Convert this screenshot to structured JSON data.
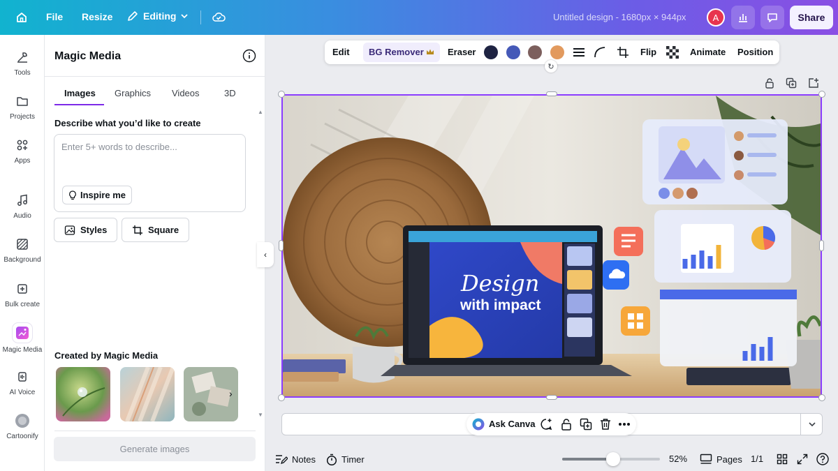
{
  "colors": {
    "accent": "#8b3dff",
    "topbar_start": "#11b3cf",
    "topbar_end": "#8a4fe4"
  },
  "topbar": {
    "file_label": "File",
    "resize_label": "Resize",
    "editing_label": "Editing",
    "design_title": "Untitled design - 1680px × 944px",
    "avatar_initial": "A",
    "share_label": "Share"
  },
  "rail": {
    "items": [
      {
        "label": "Tools",
        "icon": "tools-icon"
      },
      {
        "label": "Projects",
        "icon": "folder-icon"
      },
      {
        "label": "Apps",
        "icon": "apps-icon"
      },
      {
        "label": "Audio",
        "icon": "music-note-icon"
      },
      {
        "label": "Background",
        "icon": "background-icon"
      },
      {
        "label": "Bulk create",
        "icon": "bulk-create-icon"
      },
      {
        "label": "Magic Media",
        "icon": "magic-media-icon"
      },
      {
        "label": "AI Voice",
        "icon": "ai-voice-icon"
      },
      {
        "label": "Cartoonify",
        "icon": "cartoonify-icon"
      }
    ]
  },
  "panel": {
    "title": "Magic Media",
    "tabs": [
      "Images",
      "Graphics",
      "Videos",
      "3D"
    ],
    "active_tab": "Images",
    "prompt_label": "Describe what you’d like to create",
    "prompt_placeholder": "Enter 5+ words to describe...",
    "prompt_value": "",
    "inspire_label": "Inspire me",
    "styles_label": "Styles",
    "aspect_label": "Square",
    "created_label": "Created by Magic Media",
    "generate_label": "Generate images"
  },
  "context_toolbar": {
    "edit_label": "Edit",
    "bg_remover_label": "BG Remover",
    "eraser_label": "Eraser",
    "swatches": [
      "#1e2342",
      "#4559b8",
      "#7c5f5d",
      "#e29a5e"
    ],
    "flip_label": "Flip",
    "animate_label": "Animate",
    "position_label": "Position"
  },
  "canvas": {
    "headline_line1": "Design",
    "headline_line2": "with impact"
  },
  "ask_canva": {
    "label": "Ask Canva"
  },
  "footer": {
    "notes_label": "Notes",
    "timer_label": "Timer",
    "zoom_percent": 52,
    "zoom_label": "52%",
    "pages_label": "Pages",
    "page_count": "1/1"
  }
}
